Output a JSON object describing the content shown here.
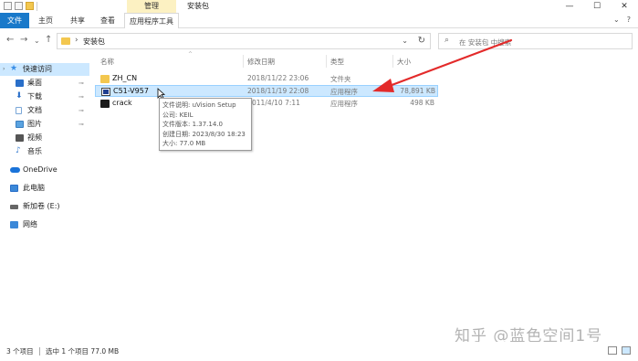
{
  "window": {
    "title": "安装包",
    "contextual_tab": "管理",
    "controls": {
      "minimize": "—",
      "maximize": "☐",
      "close": "✕"
    }
  },
  "ribbon": {
    "tabs": [
      "文件",
      "主页",
      "共享",
      "查看",
      "应用程序工具"
    ],
    "right_controls": {
      "collapse": "⌄",
      "help": "?"
    }
  },
  "address": {
    "back": "←",
    "forward": "→",
    "history": "⌄",
    "up": "↑",
    "separator": "›",
    "crumb": "安装包",
    "dropdown": "⌄",
    "refresh": "↻"
  },
  "search": {
    "icon": "⌕",
    "placeholder": "在 安装包 中搜索"
  },
  "navpane": {
    "items": [
      {
        "label": "快速访问",
        "icon": "star-icon",
        "color": "#3a8ee6"
      },
      {
        "label": "桌面",
        "icon": "desktop-icon",
        "color": "#2a6fc9",
        "pin": "📌"
      },
      {
        "label": "下载",
        "icon": "download-icon",
        "color": "#2a6fc9",
        "pin": "📌"
      },
      {
        "label": "文档",
        "icon": "document-icon",
        "color": "#7aa7d8",
        "pin": "📌"
      },
      {
        "label": "图片",
        "icon": "picture-icon",
        "color": "#5aa3e0",
        "pin": "📌"
      },
      {
        "label": "视频",
        "icon": "video-icon",
        "color": "#555555"
      },
      {
        "label": "音乐",
        "icon": "music-icon",
        "color": "#3b7fd1"
      },
      {
        "label": "OneDrive",
        "icon": "cloud-icon",
        "color": "#1a73d9"
      },
      {
        "label": "此电脑",
        "icon": "computer-icon",
        "color": "#3b88d8"
      },
      {
        "label": "新加卷 (E:)",
        "icon": "drive-icon",
        "color": "#666666"
      },
      {
        "label": "网络",
        "icon": "network-icon",
        "color": "#3b88d8"
      }
    ]
  },
  "filelist": {
    "columns": {
      "name": "名称",
      "modified": "修改日期",
      "type": "类型",
      "size": "大小"
    },
    "sort_indicator": "^",
    "rows": [
      {
        "name": "ZH_CN",
        "modified": "2018/11/22 23:06",
        "type": "文件夹",
        "size": "",
        "kind": "folder"
      },
      {
        "name": "C51-V957",
        "modified": "2018/11/19 22:08",
        "type": "应用程序",
        "size": "78,891 KB",
        "kind": "app"
      },
      {
        "name": "crack",
        "modified": "011/4/10 7:11",
        "type": "应用程序",
        "size": "498 KB",
        "kind": "crack"
      }
    ]
  },
  "tooltip": {
    "lines": [
      "文件说明: uVision Setup",
      "公司: KEIL",
      "文件版本: 1.37.14.0",
      "创建日期: 2023/8/30 18:23",
      "大小: 77.0 MB"
    ]
  },
  "annotation": {
    "arrow_color": "#e32a2a"
  },
  "watermark": "知乎 @蓝色空间1号",
  "statusbar": {
    "item_count": "3 个项目",
    "selection": "选中 1 个项目  77.0 MB"
  }
}
